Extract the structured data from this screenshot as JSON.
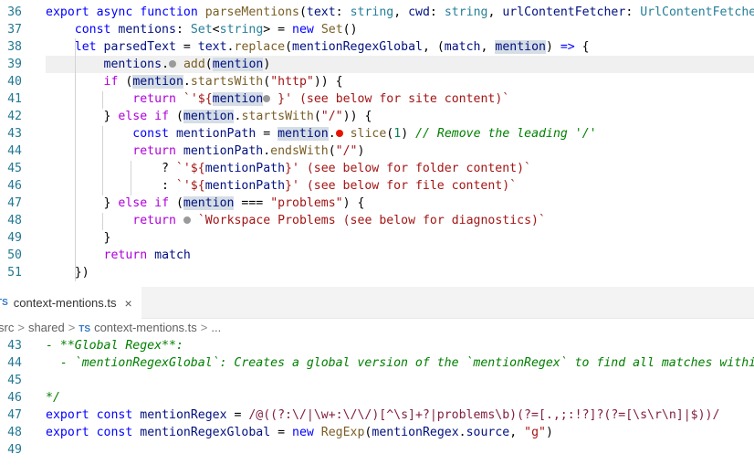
{
  "top_editor": {
    "lines": [
      {
        "n": "36",
        "html": "<span class='kw'>export</span> <span class='kw'>async</span> <span class='kw'>function</span> <span class='fn'>parseMentions</span>(<span class='var'>text</span>: <span class='type'>string</span>, <span class='var'>cwd</span>: <span class='type'>string</span>, <span class='var'>urlContentFetcher</span>: <span class='type'>UrlContentFetcher</span>):"
      },
      {
        "n": "37",
        "html": "    <span class='kw'>const</span> <span class='var'>mentions</span>: <span class='type'>Set</span>&lt;<span class='type'>string</span>&gt; = <span class='kw'>new</span> <span class='fn'>Set</span>()"
      },
      {
        "n": "38",
        "html": "    <span class='kw'>let</span> <span class='var'>parsedText</span> = <span class='var'>text</span>.<span class='fn'>replace</span>(<span class='var'>mentionRegexGlobal</span>, (<span class='var'>match</span>, <span class='var hl'>mention</span>) <span class='kw'>=&gt;</span> {"
      },
      {
        "n": "39",
        "html": "        <span class='var'>mentions</span>.<span class='dot'></span> <span class='fn'>add</span>(<span class='var hl'>mention</span>)"
      },
      {
        "n": "40",
        "html": "        <span class='ctl'>if</span> (<span class='var hl'>mention</span>.<span class='fn'>startsWith</span>(<span class='str'>\"http\"</span>)) {"
      },
      {
        "n": "41",
        "html": "            <span class='ctl'>return</span> <span class='tpl'>`'${</span><span class='var hl'>mention</span><span class='dot'></span> <span class='tpl'>}' (see below for site content)`</span>"
      },
      {
        "n": "42",
        "html": "        } <span class='ctl'>else</span> <span class='ctl'>if</span> (<span class='var hl'>mention</span>.<span class='fn'>startsWith</span>(<span class='str'>\"/\"</span>)) {"
      },
      {
        "n": "43",
        "html": "            <span class='kw'>const</span> <span class='var'>mentionPath</span> = <span class='var hl'>mention</span>.<span class='dot red'></span> <span class='fn'>slice</span>(<span class='num'>1</span>) <span class='cmt'>// Remove the leading '/'</span>"
      },
      {
        "n": "44",
        "html": "            <span class='ctl'>return</span> <span class='var'>mentionPath</span>.<span class='fn'>endsWith</span>(<span class='str'>\"/\"</span>)"
      },
      {
        "n": "45",
        "html": "                ? <span class='tpl'>`'${</span><span class='var'>mentionPath</span><span class='tpl'>}' (see below for folder content)`</span>"
      },
      {
        "n": "46",
        "html": "                : <span class='tpl'>`'${</span><span class='var'>mentionPath</span><span class='tpl'>}' (see below for file content)`</span>"
      },
      {
        "n": "47",
        "html": "        } <span class='ctl'>else</span> <span class='ctl'>if</span> (<span class='var hl'>mention</span> === <span class='str'>\"problems\"</span>) {"
      },
      {
        "n": "48",
        "html": "            <span class='ctl'>return</span> <span class='dot'></span> <span class='tpl'>`Workspace Problems (see below for diagnostics)`</span>"
      },
      {
        "n": "49",
        "html": "        }"
      },
      {
        "n": "50",
        "html": "        <span class='ctl'>return</span> <span class='var'>match</span>"
      },
      {
        "n": "51",
        "html": "    })"
      }
    ]
  },
  "tab": {
    "badge": "TS",
    "label": "context-mentions.ts",
    "close": "×"
  },
  "breadcrumb": {
    "items": [
      "src",
      "shared",
      "context-mentions.ts",
      "..."
    ],
    "badge": "TS",
    "separator": ">"
  },
  "bottom_editor": {
    "lines": [
      {
        "n": "43",
        "html": "<span class='cmt'>- **Global Regex**:</span>"
      },
      {
        "n": "44",
        "html": "<span class='cmt'>  - `mentionRegexGlobal`: Creates a global version of the `mentionRegex` to find all matches within a</span>"
      },
      {
        "n": "45",
        "html": ""
      },
      {
        "n": "46",
        "html": "<span class='cmt'>*/</span>"
      },
      {
        "n": "47",
        "html": "<span class='kw'>export</span> <span class='kw'>const</span> <span class='var'>mentionRegex</span> = <span class='re'>/@((?:\\/|\\w+:\\/\\/)[^\\s]+?|problems\\b)(?=[.,;:!?]?(?=[\\s\\r\\n]|$))/</span>"
      },
      {
        "n": "48",
        "html": "<span class='kw'>export</span> <span class='kw'>const</span> <span class='var'>mentionRegexGlobal</span> = <span class='kw'>new</span> <span class='fn'>RegExp</span>(<span class='var'>mentionRegex</span>.<span class='var'>source</span>, <span class='str'>\"g\"</span>)"
      },
      {
        "n": "49",
        "html": ""
      }
    ]
  }
}
